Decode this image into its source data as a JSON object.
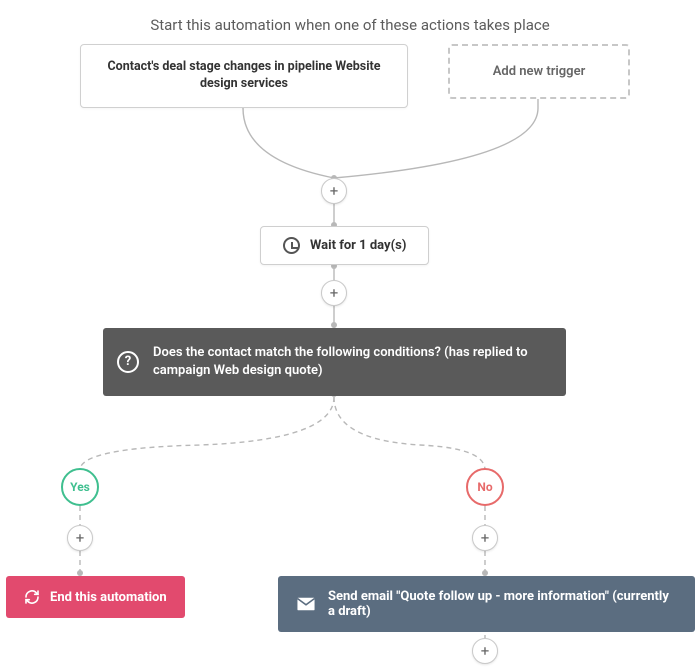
{
  "header": "Start this automation when one of these actions takes place",
  "trigger": {
    "text": "Contact's deal stage changes in pipeline Website design services"
  },
  "add_trigger_label": "Add new trigger",
  "wait": {
    "label": "Wait for 1 day(s)"
  },
  "condition": {
    "text": "Does the contact match the following conditions? (has replied to campaign Web design quote)"
  },
  "branches": {
    "yes_label": "Yes",
    "no_label": "No"
  },
  "actions": {
    "end_automation": "End this automation",
    "send_email": "Send email \"Quote follow up - more information\" (currently a draft)"
  },
  "icons": {
    "plus": "+",
    "question": "?"
  }
}
